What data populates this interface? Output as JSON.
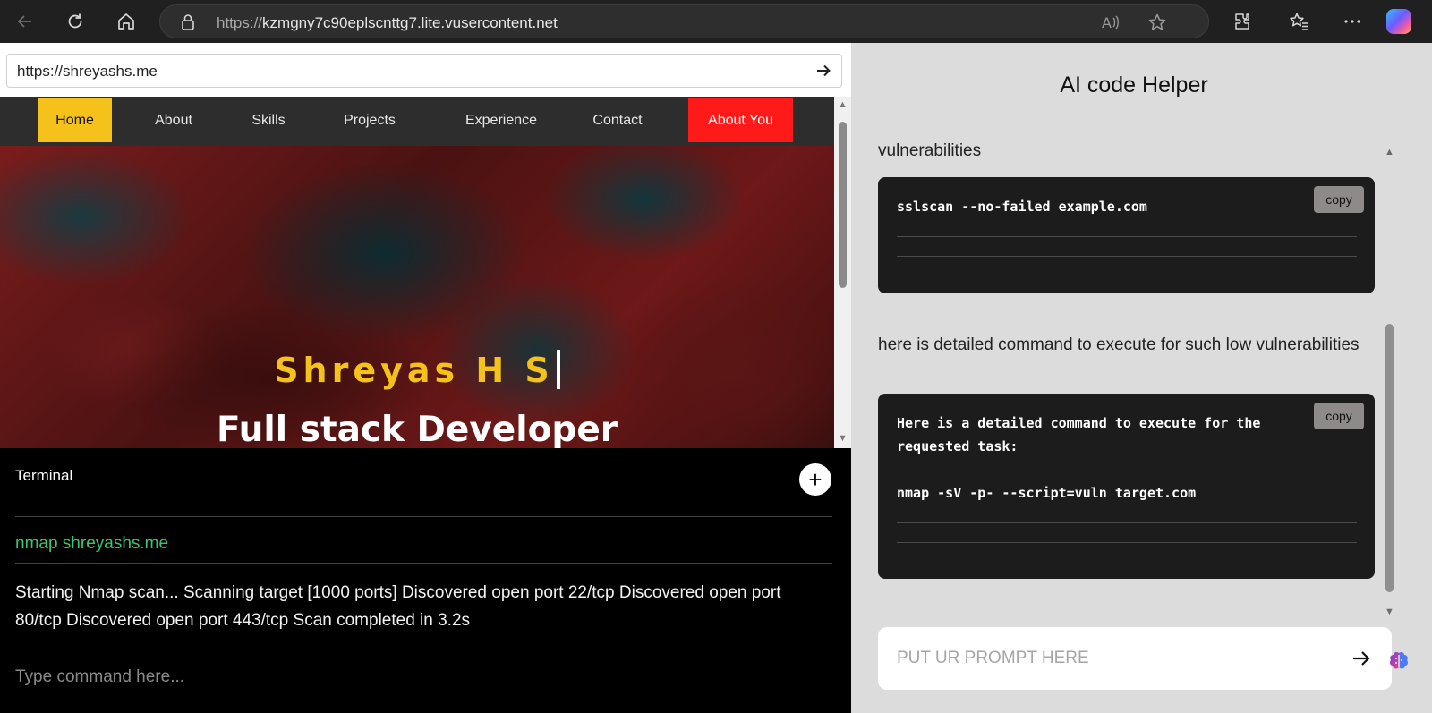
{
  "browser": {
    "url_protocol": "https://",
    "url_host": "kzmgny7c90eplscnttg7.lite.vusercontent.net",
    "icons": [
      "back-icon",
      "refresh-icon",
      "home-icon",
      "lock-icon",
      "read-aloud-icon",
      "favorite-star-icon",
      "extensions-icon",
      "favorites-icon",
      "more-icon",
      "copilot-icon"
    ]
  },
  "preview": {
    "address": "https://shreyashs.me",
    "nav": {
      "home": "Home",
      "about": "About",
      "skills": "Skills",
      "projects": "Projects",
      "experience": "Experience",
      "contact": "Contact",
      "about_you": "About You"
    },
    "hero": {
      "name": "Shreyas H S",
      "role": "Full stack Developer"
    }
  },
  "terminal": {
    "title": "Terminal",
    "add_symbol": "+",
    "command": "nmap shreyashs.me",
    "output": "Starting Nmap scan... Scanning target [1000 ports] Discovered open port 22/tcp Discovered open port 80/tcp Discovered open port 443/tcp Scan completed in 3.2s",
    "input_placeholder": "Type command here..."
  },
  "helper": {
    "title": "AI code Helper",
    "messages": [
      {
        "text": "vulnerabilities",
        "code": "sslscan --no-failed example.com",
        "copy_label": "copy"
      },
      {
        "text": "here is detailed command to execute for such low vulnerabilities",
        "code": "Here is a detailed command to execute for the\nrequested task:\n\nnmap -sV -p- --script=vuln target.com",
        "copy_label": "copy"
      }
    ],
    "prompt_placeholder": "PUT UR PROMPT HERE"
  },
  "colors": {
    "nav_home_bg": "#f4c21a",
    "nav_about_you_bg": "#ff1a1a",
    "hero_name": "#f4c21a",
    "terminal_command": "#3ec46d",
    "code_bg": "#1c1c1c"
  }
}
